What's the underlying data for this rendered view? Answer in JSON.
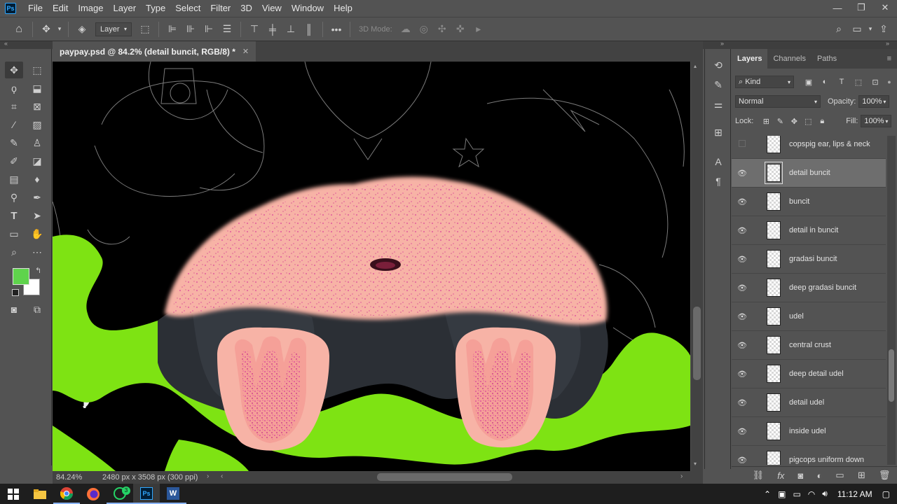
{
  "app": {
    "logo": "Ps"
  },
  "menu": [
    "File",
    "Edit",
    "Image",
    "Layer",
    "Type",
    "Select",
    "Filter",
    "3D",
    "View",
    "Window",
    "Help"
  ],
  "window_controls": {
    "minimize": "—",
    "restore": "❐",
    "close": "✕"
  },
  "options_bar": {
    "layer_select": "Layer",
    "three_d_mode": "3D Mode:",
    "more": "•••"
  },
  "document": {
    "tab_title": "paypay.psd @ 84.2% (detail buncit, RGB/8) *",
    "close": "✕",
    "zoom": "84.24%",
    "dimensions": "2480 px x 3508 px (300 ppi)"
  },
  "layers_panel": {
    "tabs": [
      "Layers",
      "Channels",
      "Paths"
    ],
    "kind_label": "Kind",
    "blend_mode": "Normal",
    "opacity_label": "Opacity:",
    "opacity_value": "100%",
    "lock_label": "Lock:",
    "fill_label": "Fill:",
    "fill_value": "100%",
    "layers": [
      {
        "name": "copspig ear, lips & neck",
        "visible": false,
        "selected": false
      },
      {
        "name": "detail buncit",
        "visible": true,
        "selected": true
      },
      {
        "name": "buncit",
        "visible": true,
        "selected": false
      },
      {
        "name": "detail in buncit",
        "visible": true,
        "selected": false
      },
      {
        "name": "gradasi buncit",
        "visible": true,
        "selected": false
      },
      {
        "name": "deep gradasi buncit",
        "visible": true,
        "selected": false
      },
      {
        "name": "udel",
        "visible": true,
        "selected": false
      },
      {
        "name": "central crust",
        "visible": true,
        "selected": false
      },
      {
        "name": "deep detail udel",
        "visible": true,
        "selected": false
      },
      {
        "name": "detail udel",
        "visible": true,
        "selected": false
      },
      {
        "name": "inside udel",
        "visible": true,
        "selected": false
      },
      {
        "name": "pigcops uniform down",
        "visible": true,
        "selected": false
      }
    ]
  },
  "colors": {
    "foreground": "#5fd34c",
    "background": "#ffffff",
    "canvas_green": "#7ee313",
    "belly_pink": "#f7b3a6",
    "speckle": "#e0559c",
    "dark_band": "#2b2f35"
  },
  "taskbar": {
    "time": "11:12 AM",
    "apps": [
      "windows-start",
      "file-explorer",
      "chrome",
      "firefox",
      "whatsapp",
      "photoshop",
      "word"
    ],
    "ps_label": "Ps",
    "word_label": "W",
    "wa_badge": "3"
  }
}
